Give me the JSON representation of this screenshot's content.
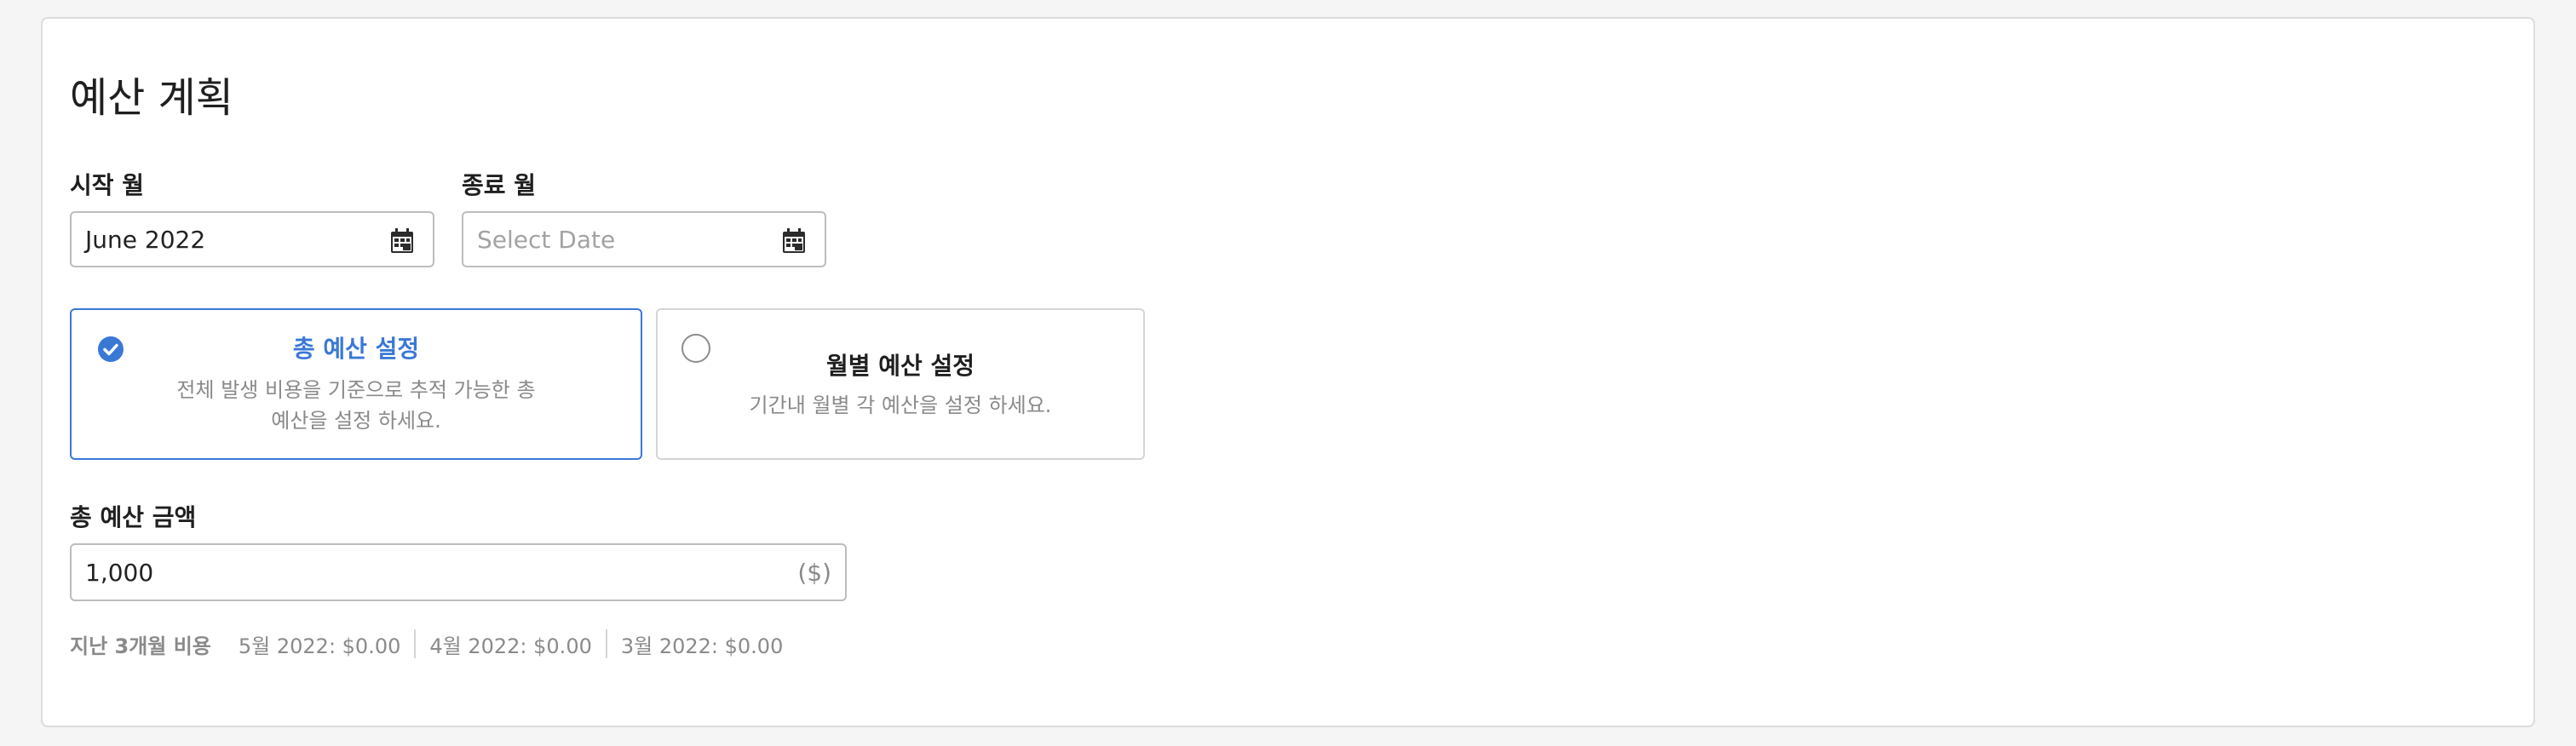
{
  "page": {
    "title": "예산 계획"
  },
  "start_month": {
    "label": "시작 월",
    "value": "June 2022"
  },
  "end_month": {
    "label": "종료 월",
    "placeholder": "Select Date"
  },
  "options": {
    "total": {
      "title": "총 예산 설정",
      "desc_line1": "전체 발생 비용을 기준으로 추적 가능한 총",
      "desc_line2": "예산을 설정 하세요.",
      "selected": true
    },
    "monthly": {
      "title": "월별 예산 설정",
      "desc": "기간내 월별 각 예산을 설정 하세요.",
      "selected": false
    }
  },
  "amount": {
    "label": "총 예산 금액",
    "value": "1,000",
    "unit": "($)"
  },
  "history": {
    "label": "지난 3개월 비용",
    "items": [
      "5월 2022: $0.00",
      "4월 2022: $0.00",
      "3월 2022: $0.00"
    ]
  },
  "colors": {
    "accent": "#3a78d6",
    "muted_text": "#8a8a8a",
    "border": "#bdbdbd"
  },
  "icons": {
    "calendar": "calendar-icon",
    "check": "check-circle-icon",
    "radio": "radio-empty-icon"
  }
}
